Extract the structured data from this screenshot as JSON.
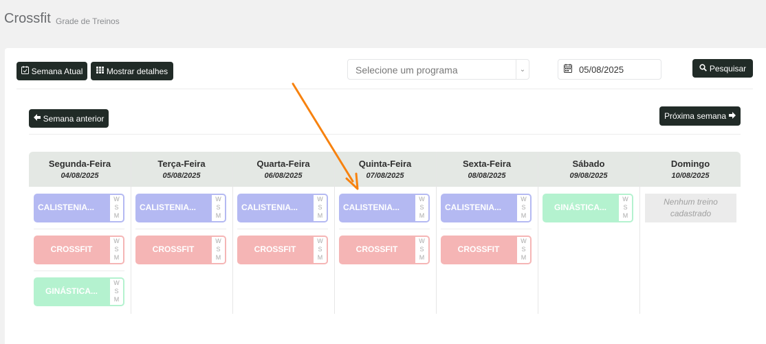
{
  "header": {
    "title": "Crossfit",
    "subtitle": "Grade de Treinos"
  },
  "toolbar": {
    "current_week": "Semana Atual",
    "show_details": "Mostrar detalhes",
    "program_placeholder": "Selecione um programa",
    "date_value": "05/08/2025",
    "search": "Pesquisar"
  },
  "nav": {
    "prev": "Semana anterior",
    "next": "Próxima semana"
  },
  "slot_letters": [
    "W",
    "S",
    "M"
  ],
  "days": [
    {
      "name": "Segunda-Feira",
      "date": "04/08/2025",
      "cards": [
        {
          "label": "CALISTENIA...",
          "color": "#b4b9f2"
        },
        {
          "label": "CROSSFIT",
          "color": "#f5b5b5"
        },
        {
          "label": "GINÁSTICA...",
          "color": "#b4f2cf"
        }
      ]
    },
    {
      "name": "Terça-Feira",
      "date": "05/08/2025",
      "cards": [
        {
          "label": "CALISTENIA...",
          "color": "#b4b9f2"
        },
        {
          "label": "CROSSFIT",
          "color": "#f5b5b5"
        }
      ]
    },
    {
      "name": "Quarta-Feira",
      "date": "06/08/2025",
      "cards": [
        {
          "label": "CALISTENIA...",
          "color": "#b4b9f2"
        },
        {
          "label": "CROSSFIT",
          "color": "#f5b5b5"
        }
      ]
    },
    {
      "name": "Quinta-Feira",
      "date": "07/08/2025",
      "cards": [
        {
          "label": "CALISTENIA...",
          "color": "#b4b9f2"
        },
        {
          "label": "CROSSFIT",
          "color": "#f5b5b5"
        }
      ]
    },
    {
      "name": "Sexta-Feira",
      "date": "08/08/2025",
      "cards": [
        {
          "label": "CALISTENIA...",
          "color": "#b4b9f2"
        },
        {
          "label": "CROSSFIT",
          "color": "#f5b5b5"
        }
      ]
    },
    {
      "name": "Sábado",
      "date": "09/08/2025",
      "cards": [
        {
          "label": "GINÁSTICA...",
          "color": "#b4f2cf"
        }
      ]
    },
    {
      "name": "Domingo",
      "date": "10/08/2025",
      "cards": [],
      "empty_text": "Nenhum treino cadastrado"
    }
  ],
  "annotation": {
    "arrow_color": "#f7820f"
  }
}
